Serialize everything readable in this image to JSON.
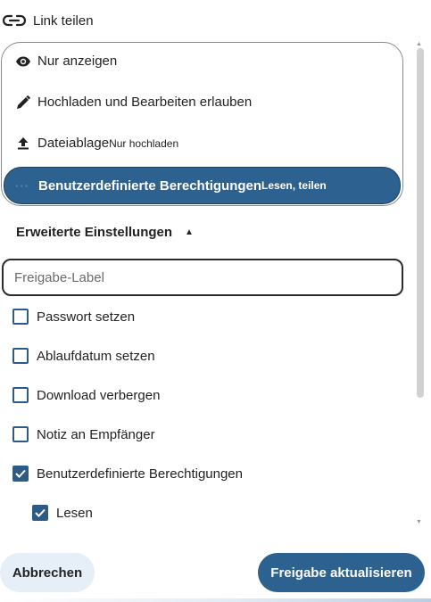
{
  "header": {
    "title": "Link teilen",
    "icon": "link-icon"
  },
  "menu": {
    "options": [
      {
        "label": "Nur anzeigen",
        "sub": "",
        "icon": "eye-icon"
      },
      {
        "label": "Hochladen und Bearbeiten erlauben",
        "sub": "",
        "icon": "pencil-icon"
      },
      {
        "label": "Dateiablage",
        "sub": "Nur hochladen",
        "icon": "upload-icon"
      },
      {
        "label": "Benutzerdefinierte Berechtigungen",
        "sub": "Lesen, teilen",
        "icon": "dots-icon",
        "selected": true
      }
    ],
    "dots": "···"
  },
  "advanced": {
    "title": "Erweiterte Einstellungen",
    "caret": "▲"
  },
  "label_input": {
    "placeholder": "Freigabe-Label",
    "value": ""
  },
  "checkboxes": [
    {
      "label": "Passwort setzen",
      "checked": false
    },
    {
      "label": "Ablaufdatum setzen",
      "checked": false
    },
    {
      "label": "Download verbergen",
      "checked": false
    },
    {
      "label": "Notiz an Empfänger",
      "checked": false
    },
    {
      "label": "Benutzerdefinierte Berechtigungen",
      "checked": true
    },
    {
      "label": "Lesen",
      "checked": true
    }
  ],
  "buttons": {
    "cancel": "Abbrechen",
    "update": "Freigabe aktualisieren"
  },
  "colors": {
    "accent": "#2d6290",
    "checkbox": "#2d5b86",
    "cancel_bg": "#e6eef8"
  },
  "scroll_arrows": {
    "up": "▲",
    "down": "▼"
  }
}
